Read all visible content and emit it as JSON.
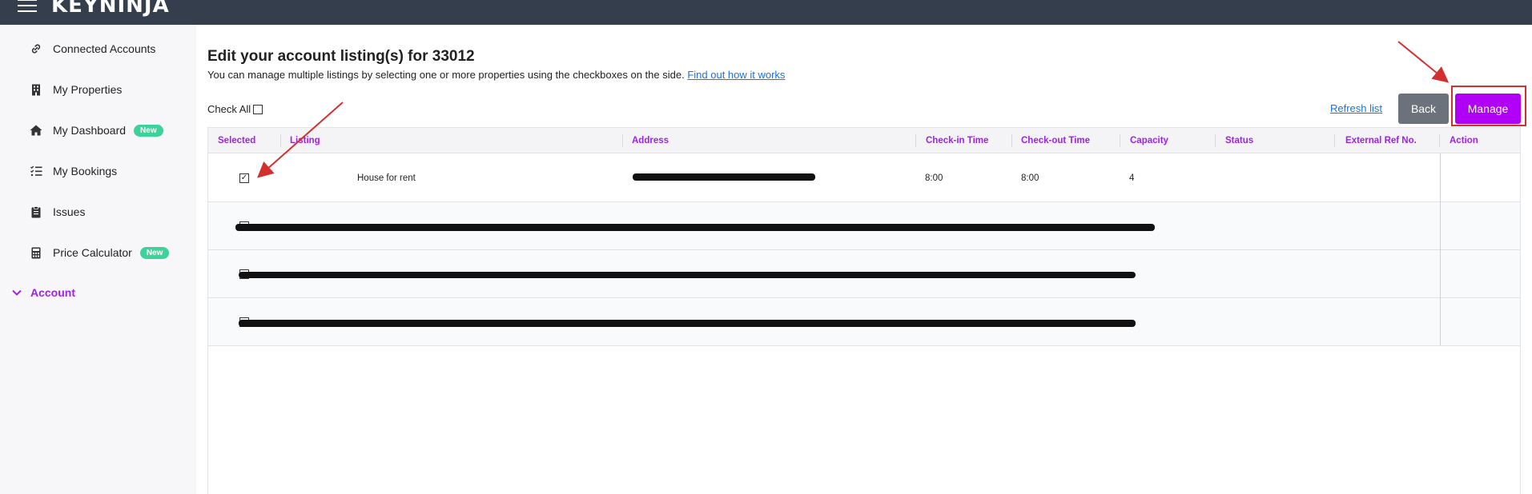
{
  "header": {
    "logo": "KEYNINJA"
  },
  "sidebar": {
    "items": [
      {
        "label": "Connected Accounts",
        "icon": "link-icon"
      },
      {
        "label": "My Properties",
        "icon": "building-icon"
      },
      {
        "label": "My Dashboard",
        "icon": "home-icon",
        "badge": "New"
      },
      {
        "label": "My Bookings",
        "icon": "checklist-icon"
      },
      {
        "label": "Issues",
        "icon": "clipboard-icon"
      },
      {
        "label": "Price Calculator",
        "icon": "calculator-icon",
        "badge": "New"
      }
    ],
    "account_label": "Account"
  },
  "page": {
    "title": "Edit your account listing(s) for 33012",
    "subtitle": "You can manage multiple listings by selecting one or more properties using the checkboxes on the side.",
    "help_link": "Find out how it works",
    "check_all": "Check All",
    "refresh": "Refresh list",
    "back": "Back",
    "manage": "Manage"
  },
  "table": {
    "columns": [
      "Selected",
      "Listing",
      "Address",
      "Check-in Time",
      "Check-out Time",
      "Capacity",
      "Status",
      "External Ref No.",
      "Action"
    ],
    "rows": [
      {
        "selected": true,
        "listing": "House for rent",
        "address": "",
        "checkin": "8:00",
        "checkout": "8:00",
        "capacity": "4",
        "status": "",
        "ref": "",
        "redacted": false
      },
      {
        "selected": false,
        "listing": "",
        "address": "",
        "checkin": "",
        "checkout": "",
        "capacity": "",
        "status": "",
        "ref": "",
        "redacted": true
      },
      {
        "selected": false,
        "listing": "",
        "address": "",
        "checkin": "",
        "checkout": "",
        "capacity": "",
        "status": "",
        "ref": "",
        "redacted": true
      },
      {
        "selected": false,
        "listing": "",
        "address": "",
        "checkin": "",
        "checkout": "",
        "capacity": "",
        "status": "",
        "ref": "",
        "redacted": true
      }
    ]
  },
  "colors": {
    "accent": "#a020f0",
    "manage": "#b000f5",
    "back": "#6b727b",
    "badge": "#3bd39a",
    "topbar": "#343e4c",
    "annotation": "#d32f2f"
  }
}
